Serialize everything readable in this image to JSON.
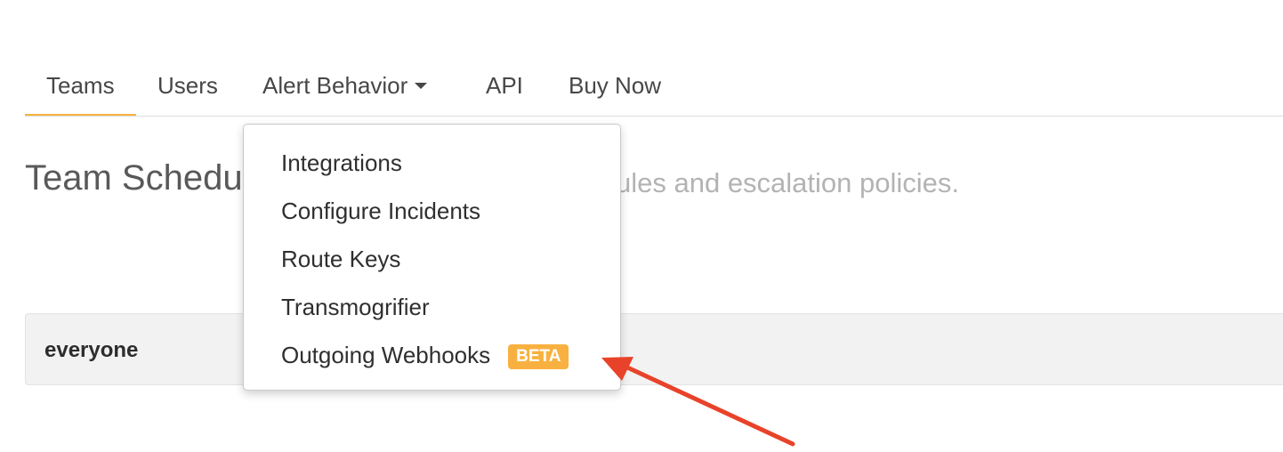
{
  "nav": {
    "tabs": [
      {
        "label": "Teams",
        "active": true
      },
      {
        "label": "Users"
      },
      {
        "label": "Alert Behavior",
        "has_dropdown": true
      },
      {
        "label": "API"
      },
      {
        "label": "Buy Now"
      }
    ]
  },
  "page": {
    "title": "Team Schedul",
    "subtitle": "ules and escalation policies."
  },
  "teams": [
    {
      "name": "everyone"
    }
  ],
  "dropdown": {
    "items": [
      {
        "label": "Integrations"
      },
      {
        "label": "Configure Incidents"
      },
      {
        "label": "Route Keys"
      },
      {
        "label": "Transmogrifier"
      },
      {
        "label": "Outgoing Webhooks",
        "badge": "BETA"
      }
    ]
  },
  "colors": {
    "accent": "#f8b140",
    "annotation_arrow": "#e8432a"
  },
  "icons": {
    "dropdown_caret": "chevron-down-icon",
    "annotation": "red-arrow"
  }
}
